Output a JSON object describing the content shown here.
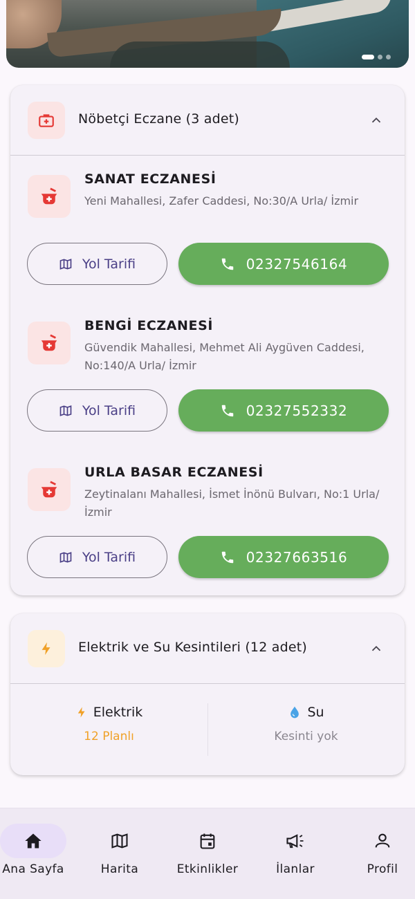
{
  "colors": {
    "accent_green": "#66ad5b",
    "pharmacy_red": "#e53935",
    "bolt_orange": "#f0a128",
    "water_blue": "#4aa3e6",
    "nav_active_bg": "#e8def8"
  },
  "hero": {
    "slides_count": 3,
    "active_slide": 1
  },
  "pharmacy_section": {
    "icon": "first-aid-kit-icon",
    "title": "Nöbetçi Eczane (3 adet)",
    "expanded": true,
    "items": [
      {
        "name": "SANAT ECZANESİ",
        "address": "Yeni Mahallesi, Zafer Caddesi, No:30/A Urla/ İzmir",
        "route_label": "Yol Tarifi",
        "phone": "02327546164"
      },
      {
        "name": "BENGİ ECZANESİ",
        "address": "Güvendik Mahallesi, Mehmet Ali Aygüven Caddesi, No:140/A Urla/ İzmir",
        "route_label": "Yol Tarifi",
        "phone": "02327552332"
      },
      {
        "name": "URLA BASAR ECZANESİ",
        "address": "Zeytinalanı Mahallesi, İsmet İnönü Bulvarı, No:1 Urla/İzmir",
        "route_label": "Yol Tarifi",
        "phone": "02327663516"
      }
    ]
  },
  "outage_section": {
    "icon": "lightning-bolt-icon",
    "title": "Elektrik ve Su Kesintileri (12 adet)",
    "expanded": true,
    "electricity": {
      "label": "Elektrik",
      "value": "12 Planlı"
    },
    "water": {
      "label": "Su",
      "value": "Kesinti yok"
    }
  },
  "bottom_nav": {
    "items": [
      {
        "label": "Ana Sayfa",
        "icon": "home-icon",
        "active": true
      },
      {
        "label": "Harita",
        "icon": "map-icon",
        "active": false
      },
      {
        "label": "Etkinlikler",
        "icon": "calendar-icon",
        "active": false
      },
      {
        "label": "İlanlar",
        "icon": "megaphone-icon",
        "active": false
      },
      {
        "label": "Profil",
        "icon": "person-icon",
        "active": false
      }
    ]
  }
}
